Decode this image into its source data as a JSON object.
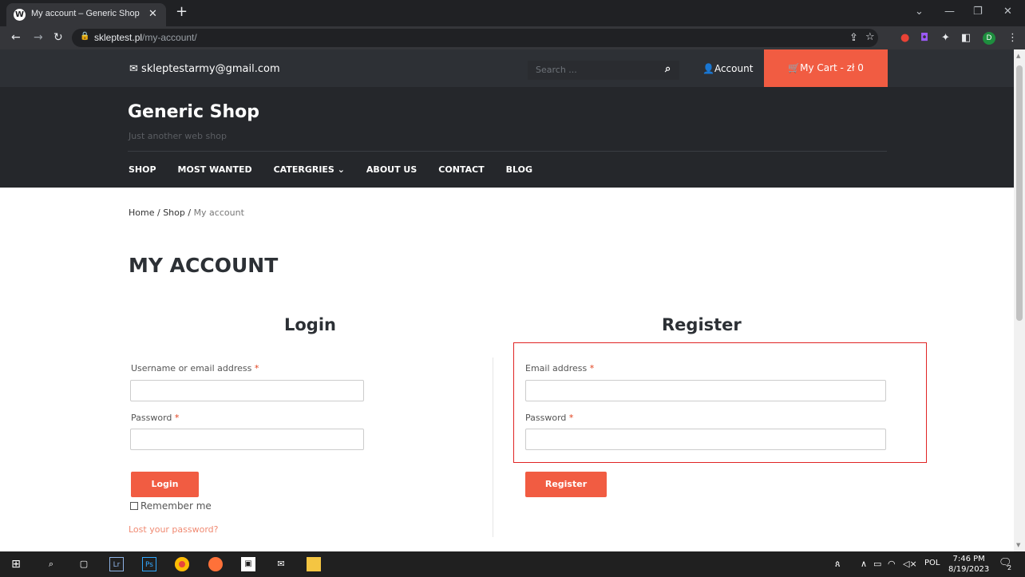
{
  "browser": {
    "tab_title": "My account – Generic Shop",
    "favicon_letter": "W",
    "url_host": "skleptest.pl",
    "url_path": "/my-account/",
    "profile_initial": "D"
  },
  "topbar": {
    "email": "skleptestarmy@gmail.com",
    "search_placeholder": "Search ...",
    "account_label": "Account",
    "cart_label": "My Cart - zł 0",
    "cart_color": "#f15c42"
  },
  "header": {
    "site_title": "Generic Shop",
    "tagline": "Just another web shop",
    "nav": [
      "SHOP",
      "MOST WANTED",
      "CATERGRIES",
      "ABOUT US",
      "CONTACT",
      "BLOG"
    ]
  },
  "breadcrumb": {
    "home": "Home",
    "sep1": " / ",
    "shop": "Shop",
    "sep2": " / ",
    "current": "My account"
  },
  "page_title": "MY ACCOUNT",
  "login": {
    "heading": "Login",
    "username_label": "Username or email address",
    "password_label": "Password",
    "required_mark": "*",
    "button": "Login",
    "remember": "Remember me",
    "lost_password": "Lost your password?"
  },
  "register": {
    "heading": "Register",
    "email_label": "Email address",
    "password_label": "Password",
    "required_mark": "*",
    "button": "Register"
  },
  "taskbar": {
    "tray_lang": "POL",
    "time": "7:46 PM",
    "date": "8/19/2023",
    "notif_count": "2"
  }
}
